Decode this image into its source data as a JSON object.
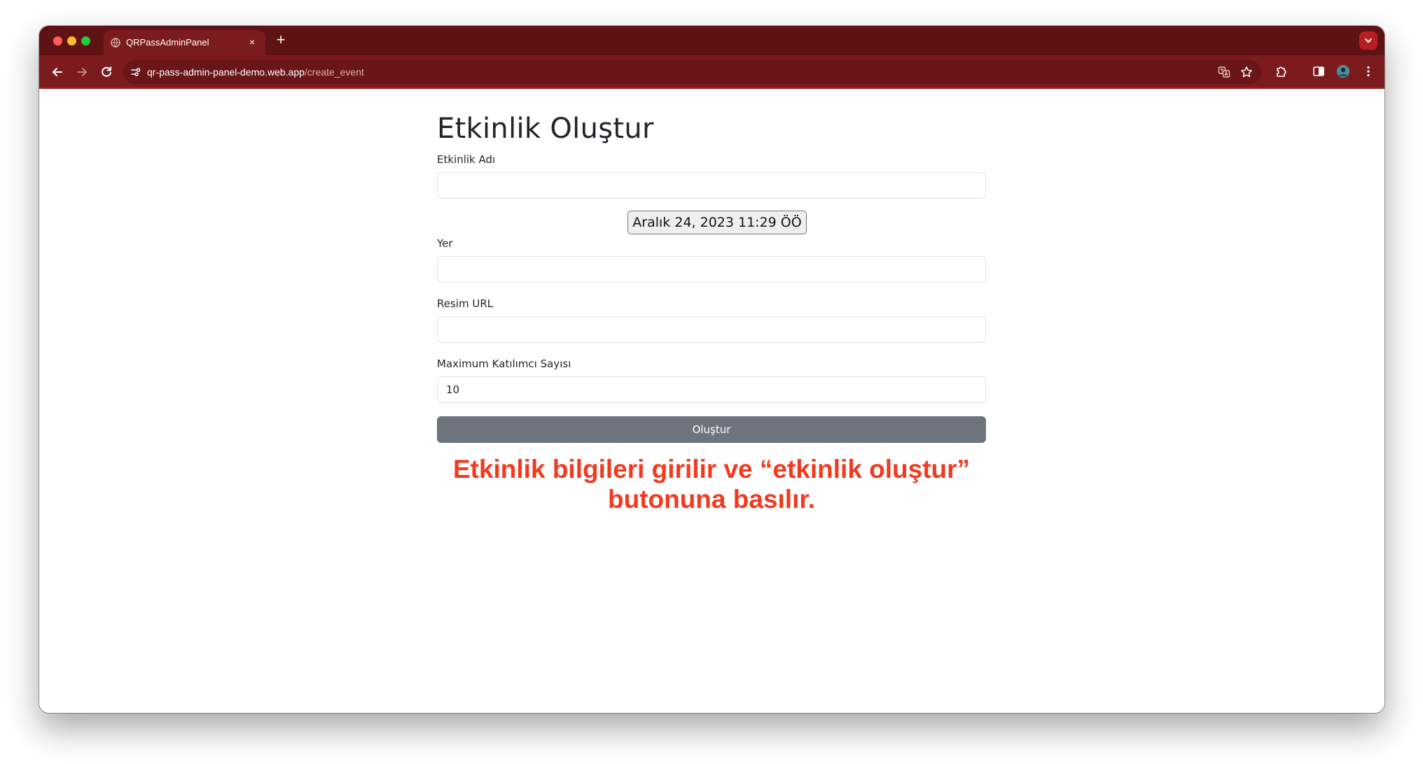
{
  "browser": {
    "tab": {
      "title": "QRPassAdminPanel"
    },
    "new_tab_label": "+",
    "tab_close_label": "×",
    "url_host": "qr-pass-admin-panel-demo.web.app",
    "url_path": "/create_event",
    "colors": {
      "tabstrip": "#5e1214",
      "toolbar": "#7b1b1e"
    },
    "icons": {
      "back": "arrow-left-icon",
      "forward": "arrow-right-icon",
      "reload": "reload-icon",
      "site_info": "tune-icon",
      "translate": "translate-icon",
      "bookmark": "star-icon",
      "extensions": "puzzle-icon",
      "side_panel": "side-panel-icon",
      "profile": "avatar-icon",
      "menu": "kebab-menu-icon",
      "tab_search": "chevron-down-icon"
    }
  },
  "form": {
    "title": "Etkinlik Oluştur",
    "event_name_label": "Etkinlik Adı",
    "event_name_value": "",
    "date_value": "Aralık 24, 2023 11:29 ÖÖ",
    "location_label": "Yer",
    "location_value": "",
    "image_url_label": "Resim URL",
    "image_url_value": "",
    "max_participants_label": "Maximum Katılımcı Sayısı",
    "max_participants_value": "10",
    "submit_label": "Oluştur"
  },
  "annotation": {
    "line1": "Etkinlik bilgileri girilir ve “etkinlik oluştur”",
    "line2": "butonuna basılır.",
    "color": "#f23a1f"
  }
}
